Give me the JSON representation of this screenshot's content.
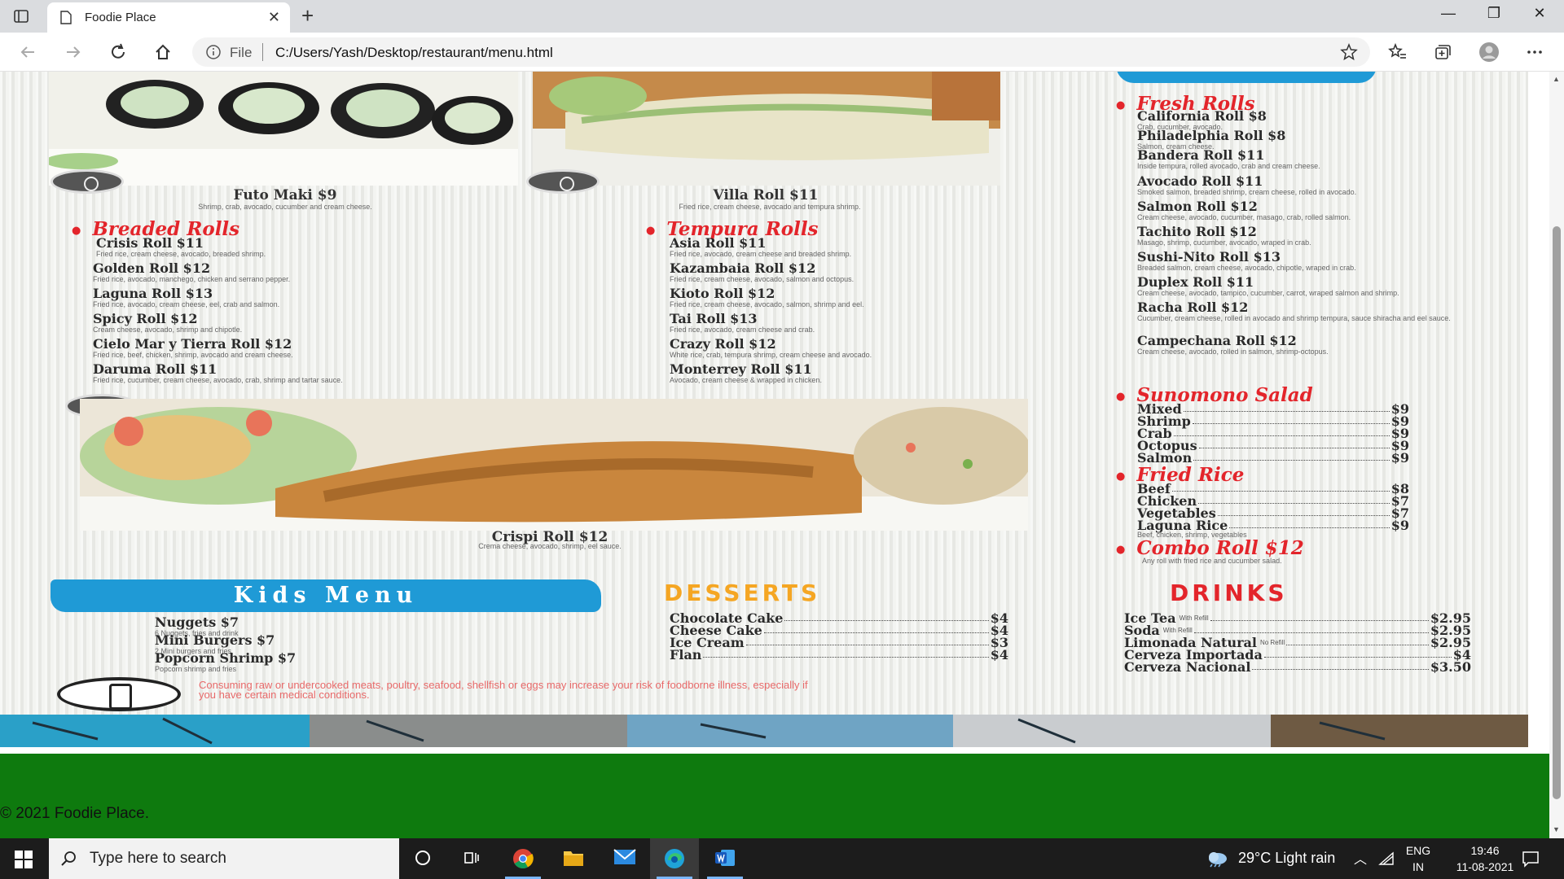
{
  "browser": {
    "tab_title": "Foodie Place",
    "address_scheme": "File",
    "address_url": "C:/Users/Yash/Desktop/restaurant/menu.html"
  },
  "menu": {
    "photos_top": [
      {
        "title": "Futo Maki $9",
        "desc": "Shrimp, crab, avocado, cucumber and cream cheese."
      },
      {
        "title": "Villa Roll $11",
        "desc": "Fried rice, cream cheese, avocado and tempura shrimp."
      }
    ],
    "breaded": {
      "heading": "Breaded Rolls",
      "items": [
        {
          "name": "Crisis Roll $11",
          "desc": "Fried rice, cream cheese, avocado, breaded shrimp."
        },
        {
          "name": "Golden Roll $12",
          "desc": "Fried rice, avocado, manchego, chicken and serrano pepper."
        },
        {
          "name": "Laguna Roll $13",
          "desc": "Fried rice, avocado, cream cheese, eel, crab and salmon."
        },
        {
          "name": "Spicy Roll $12",
          "desc": "Cream cheese, avocado, shrimp and chipotle."
        },
        {
          "name": "Cielo Mar y Tierra Roll $12",
          "desc": "Fried rice, beef, chicken, shrimp, avocado and cream cheese."
        },
        {
          "name": "Daruma Roll $11",
          "desc": "Fried rice, cucumber, cream cheese, avocado, crab, shrimp and tartar sauce."
        }
      ]
    },
    "tempura": {
      "heading": "Tempura Rolls",
      "items": [
        {
          "name": "Asia Roll $11",
          "desc": "Fried rice, avocado, cream cheese and breaded shrimp."
        },
        {
          "name": "Kazambaia Roll $12",
          "desc": "Fried rice, cream cheese, avocado, salmon and octopus."
        },
        {
          "name": "Kioto Roll $12",
          "desc": "Fried rice, cream cheese, avocado, salmon, shrimp and eel."
        },
        {
          "name": "Tai Roll $13",
          "desc": "Fried rice, avocado, cream cheese and crab."
        },
        {
          "name": "Crazy Roll $12",
          "desc": "White rice, crab, tempura shrimp, cream cheese and avocado."
        },
        {
          "name": "Monterrey Roll $11",
          "desc": "Avocado, cream cheese & wrapped in chicken."
        }
      ]
    },
    "fresh": {
      "heading": "Fresh Rolls",
      "items": [
        {
          "name": "California Roll $8",
          "desc": "Crab, cucumber, avocado."
        },
        {
          "name": "Philadelphia Roll $8",
          "desc": "Salmon, cream cheese."
        },
        {
          "name": "Bandera Roll $11",
          "desc": "Inside tempura, rolled avocado, crab and cream cheese."
        },
        {
          "name": "Avocado Roll $11",
          "desc": "Smoked salmon, breaded shrimp, cream cheese, rolled in avocado."
        },
        {
          "name": "Salmon Roll $12",
          "desc": "Cream cheese, avocado, cucumber, masago, crab, rolled salmon."
        },
        {
          "name": "Tachito Roll $12",
          "desc": "Masago, shrimp, cucumber, avocado, wraped in crab."
        },
        {
          "name": "Sushi-Nito Roll $13",
          "desc": "Breaded salmon, cream cheese, avocado, chipotle, wraped in crab."
        },
        {
          "name": "Duplex Roll $11",
          "desc": "Cream cheese, avocado, tampico, cucumber, carrot, wraped salmon and shrimp."
        },
        {
          "name": "Racha Roll $12",
          "desc": "Cucumber, cream cheese, rolled in avocado and shrimp tempura, sauce shiracha and eel sauce."
        },
        {
          "name": "Campechana Roll $12",
          "desc": "Cream cheese, avocado, rolled in salmon, shrimp-octopus."
        }
      ]
    },
    "crispi": {
      "title": "Crispi Roll $12",
      "desc": "Crema cheese, avocado, shrimp, eel sauce."
    },
    "sunomono": {
      "heading": "Sunomono Salad",
      "items": [
        {
          "name": "Mixed",
          "price": "$9"
        },
        {
          "name": "Shrimp",
          "price": "$9"
        },
        {
          "name": "Crab",
          "price": "$9"
        },
        {
          "name": "Octopus",
          "price": "$9"
        },
        {
          "name": "Salmon",
          "price": "$9"
        }
      ]
    },
    "fried_rice": {
      "heading": "Fried Rice",
      "items": [
        {
          "name": "Beef",
          "price": "$8"
        },
        {
          "name": "Chicken",
          "price": "$7"
        },
        {
          "name": "Vegetables",
          "price": "$7"
        },
        {
          "name": "Laguna Rice",
          "price": "$9"
        }
      ],
      "note": "Beef, chicken, shrimp, vegetables"
    },
    "combo": {
      "heading": "Combo Roll $12",
      "desc": "Any roll with fried rice and cucumber salad."
    },
    "kids": {
      "heading": "Kids Menu",
      "items": [
        {
          "name": "Nuggets $7",
          "desc": "6 Nuggets, fries and drink"
        },
        {
          "name": "Mini Burgers $7",
          "desc": "2 Mini burgers and fries"
        },
        {
          "name": "Popcorn Shrimp $7",
          "desc": "Popcorn shrimp and fries"
        }
      ]
    },
    "desserts": {
      "heading": "DESSERTS",
      "items": [
        {
          "name": "Chocolate Cake",
          "price": "$4"
        },
        {
          "name": "Cheese Cake",
          "price": "$4"
        },
        {
          "name": "Ice Cream",
          "price": "$3"
        },
        {
          "name": "Flan",
          "price": "$4"
        }
      ]
    },
    "drinks": {
      "heading": "DRINKS",
      "items": [
        {
          "name": "Ice Tea",
          "note": "With Refill",
          "price": "$2.95"
        },
        {
          "name": "Soda",
          "note": "With Refill",
          "price": "$2.95"
        },
        {
          "name": "Limonada Natural",
          "note": "No Refill",
          "price": "$2.95"
        },
        {
          "name": "Cerveza Importada",
          "note": "",
          "price": "$4"
        },
        {
          "name": "Cerveza Nacional",
          "note": "",
          "price": "$3.50"
        }
      ]
    },
    "warning": "Consuming raw or undercooked meats, poultry, seafood, shellfish or eggs may increase your risk of foodborne illness, especially if you have certain medical conditions."
  },
  "footer": {
    "text": "© 2021 Foodie Place."
  },
  "taskbar": {
    "search_placeholder": "Type here to search",
    "weather": "29°C  Light rain",
    "lang": "ENG",
    "region": "IN",
    "time": "19:46",
    "date": "11-08-2021"
  },
  "colors": {
    "menu_red": "#e3252b",
    "kids_blue": "#1f9ad6",
    "desserts_orange": "#f5a623",
    "footer_green": "#0e7a0e"
  }
}
